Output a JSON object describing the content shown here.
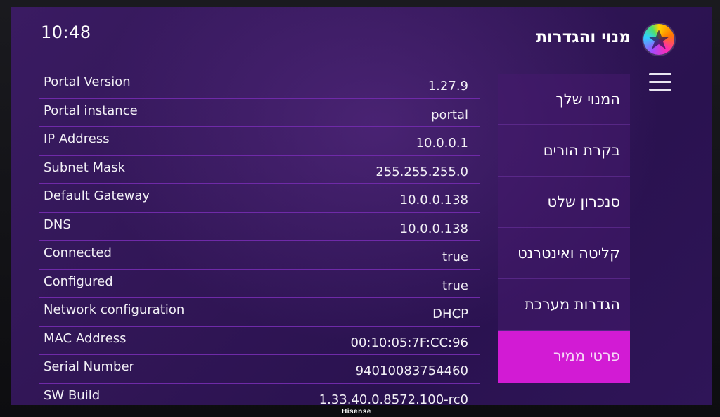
{
  "header": {
    "time": "10:48",
    "title": "מנוי והגדרות"
  },
  "info_rows": [
    {
      "label": "Portal Version",
      "value": "1.27.9"
    },
    {
      "label": "Portal instance",
      "value": "portal"
    },
    {
      "label": "IP Address",
      "value": "10.0.0.1"
    },
    {
      "label": "Subnet Mask",
      "value": "255.255.255.0"
    },
    {
      "label": "Default Gateway",
      "value": "10.0.0.138"
    },
    {
      "label": "DNS",
      "value": "10.0.0.138"
    },
    {
      "label": "Connected",
      "value": "true"
    },
    {
      "label": "Configured",
      "value": "true"
    },
    {
      "label": "Network configuration",
      "value": "DHCP"
    },
    {
      "label": "MAC Address",
      "value": "00:10:05:7F:CC:96"
    },
    {
      "label": "Serial Number",
      "value": "94010083754460"
    },
    {
      "label": "SW Build",
      "value": "1.33.40.0.8572.100-rc0"
    }
  ],
  "menu": {
    "items": [
      {
        "label": "המנוי שלך"
      },
      {
        "label": "בקרת הורים"
      },
      {
        "label": "סנכרון שלט"
      },
      {
        "label": "קליטה ואינטרנט"
      },
      {
        "label": "הגדרות מערכת"
      },
      {
        "label": "פרטי ממיר",
        "active": true
      }
    ]
  },
  "bezel": {
    "brand": "Hisense"
  },
  "colors": {
    "background": "#311656",
    "divider": "#6f2aa8",
    "active_menu": "#d21bd4"
  },
  "icons": {
    "logo": "colorful-star-logo-icon",
    "menu": "hamburger-menu-icon"
  }
}
